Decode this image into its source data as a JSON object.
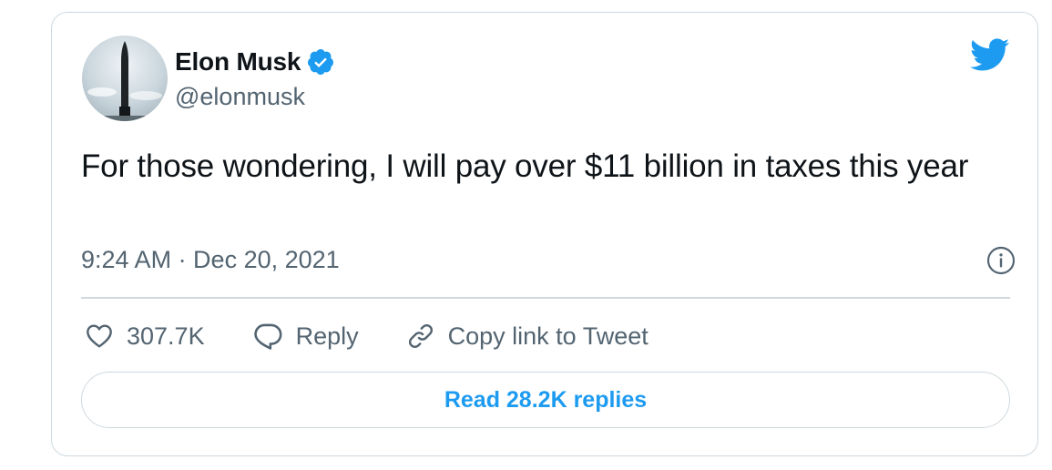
{
  "author": {
    "name": "Elon Musk",
    "handle": "@elonmusk",
    "verified": true,
    "avatar_icon": "starship-avatar"
  },
  "brand": {
    "icon": "twitter-bird-icon",
    "color": "#1d9bf0"
  },
  "tweet": {
    "text": "For those wondering, I will pay over $11 billion in taxes this year",
    "timestamp": "9:24 AM · Dec 20, 2021"
  },
  "actions": {
    "likes": "307.7K",
    "reply_label": "Reply",
    "copy_link_label": "Copy link to Tweet"
  },
  "replies_button": {
    "label": "Read 28.2K replies"
  },
  "colors": {
    "text_primary": "#0f1419",
    "text_secondary": "#536471",
    "border": "#cfd9de",
    "accent": "#1d9bf0"
  }
}
